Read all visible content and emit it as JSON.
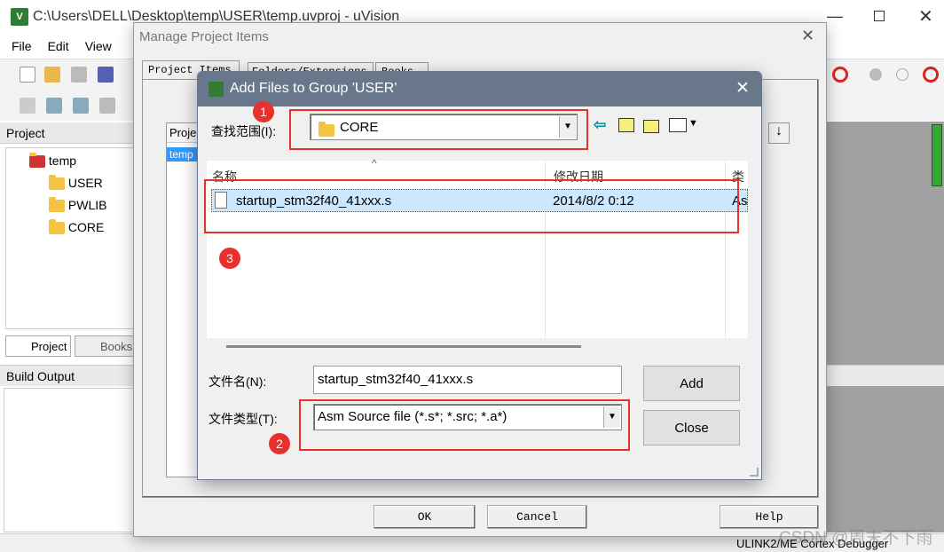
{
  "main_window": {
    "title": "C:\\Users\\DELL\\Desktop\\temp\\USER\\temp.uvproj - uVision",
    "menu": [
      "File",
      "Edit",
      "View"
    ],
    "project_panel": {
      "title": "Project",
      "tree": [
        {
          "label": "temp"
        },
        {
          "label": "USER"
        },
        {
          "label": "PWLIB"
        },
        {
          "label": "CORE"
        }
      ],
      "tabs": [
        "Project",
        "Books"
      ]
    },
    "build_output": {
      "title": "Build Output"
    },
    "status": "ULINK2/ME Cortex Debugger"
  },
  "manage_dialog": {
    "title": "Manage Project Items",
    "tabs": [
      "Project Items",
      "Folders/Extensions",
      "Books"
    ],
    "list_header": "Proje",
    "list_item": "temp",
    "buttons": {
      "ok": "OK",
      "cancel": "Cancel",
      "help": "Help"
    }
  },
  "add_dialog": {
    "title": "Add Files to Group 'USER'",
    "look_in_label": "查找范围(I):",
    "look_in_value": "CORE",
    "columns": [
      "名称",
      "修改日期",
      "类"
    ],
    "files": [
      {
        "name": "startup_stm32f40_41xxx.s",
        "modified": "2014/8/2 0:12",
        "type": "As"
      }
    ],
    "filename_label": "文件名(N):",
    "filename_value": "startup_stm32f40_41xxx.s",
    "filetype_label": "文件类型(T):",
    "filetype_value": "Asm Source file (*.s*; *.src; *.a*)",
    "add_label": "Add",
    "close_label": "Close"
  },
  "annotations": [
    "1",
    "2",
    "3"
  ],
  "watermark": "CSDN @周末不下雨",
  "colors": {
    "dialog_titlebar": "#68788a",
    "selection": "#cce8ff",
    "annotation": "#e8302c"
  }
}
